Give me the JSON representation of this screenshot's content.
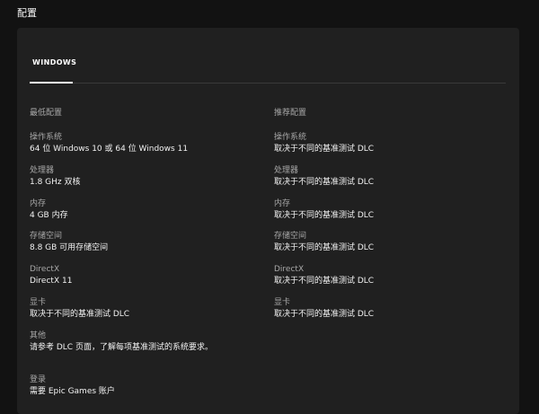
{
  "page": {
    "title": "配置"
  },
  "tabs": [
    {
      "label": "WINDOWS",
      "selected": true
    }
  ],
  "minimum": {
    "heading": "最低配置",
    "specs": [
      {
        "label": "操作系统",
        "value": "64 位 Windows 10 或 64 位 Windows 11"
      },
      {
        "label": "处理器",
        "value": "1.8 GHz 双核"
      },
      {
        "label": "内存",
        "value": "4 GB 内存"
      },
      {
        "label": "存储空间",
        "value": "8.8 GB 可用存储空间"
      },
      {
        "label": "DirectX",
        "value": "DirectX 11"
      },
      {
        "label": "显卡",
        "value": "取决于不同的基准测试 DLC"
      },
      {
        "label": "其他",
        "value": "请参考 DLC 页面，了解每项基准测试的系统要求。"
      },
      {
        "label": "登录",
        "value": "需要 Epic Games 账户"
      }
    ]
  },
  "recommended": {
    "heading": "推荐配置",
    "specs": [
      {
        "label": "操作系统",
        "value": "取决于不同的基准测试 DLC"
      },
      {
        "label": "处理器",
        "value": "取决于不同的基准测试 DLC"
      },
      {
        "label": "内存",
        "value": "取决于不同的基准测试 DLC"
      },
      {
        "label": "存储空间",
        "value": "取决于不同的基准测试 DLC"
      },
      {
        "label": "DirectX",
        "value": "取决于不同的基准测试 DLC"
      },
      {
        "label": "显卡",
        "value": "取决于不同的基准测试 DLC"
      }
    ]
  }
}
